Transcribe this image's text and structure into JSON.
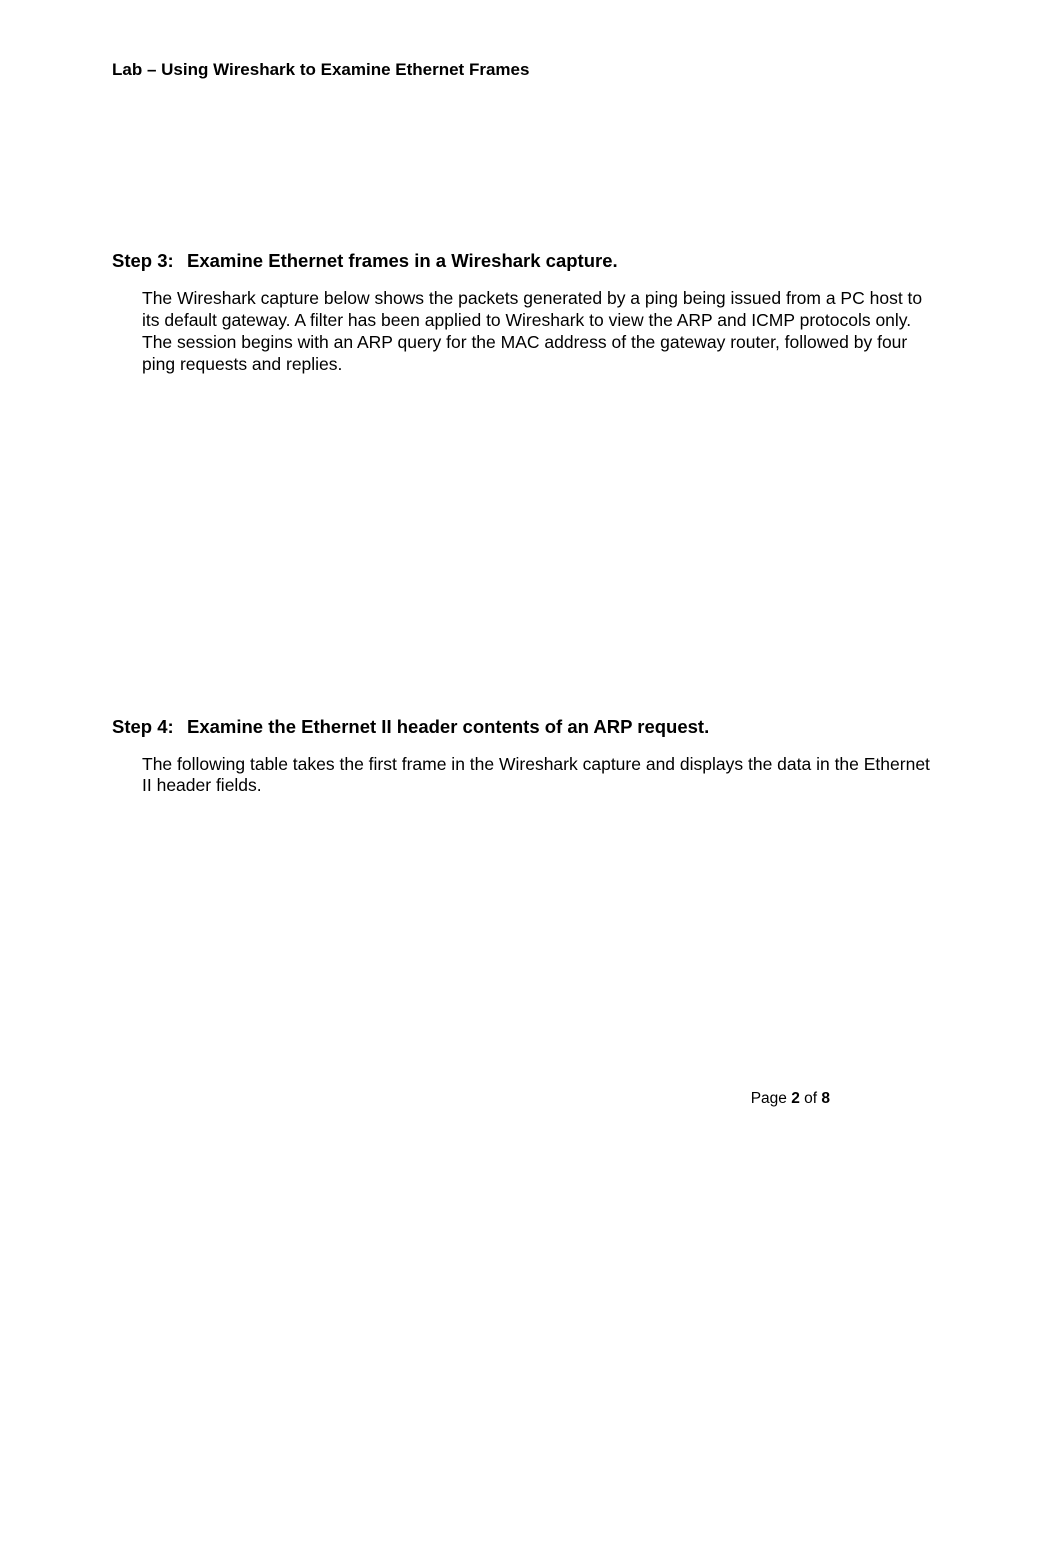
{
  "header": {
    "running_title": "Lab – Using Wireshark to Examine Ethernet Frames"
  },
  "step3": {
    "label": "Step 3:",
    "title": "Examine Ethernet frames in a Wireshark capture.",
    "body": "The Wireshark capture below shows the packets generated by a ping being issued from a PC host to its default gateway. A filter has been applied to Wireshark to view the ARP and ICMP protocols only. The session begins with an ARP query for the MAC address of the gateway router, followed by four ping requests and replies."
  },
  "step4": {
    "label": "Step 4:",
    "title": "Examine the Ethernet II header contents of an ARP request.",
    "body": "The following table takes the first frame in the Wireshark capture and displays the data in the Ethernet II header fields."
  },
  "footer": {
    "prefix": "Page ",
    "current": "2",
    "of": " of ",
    "total": "8"
  }
}
